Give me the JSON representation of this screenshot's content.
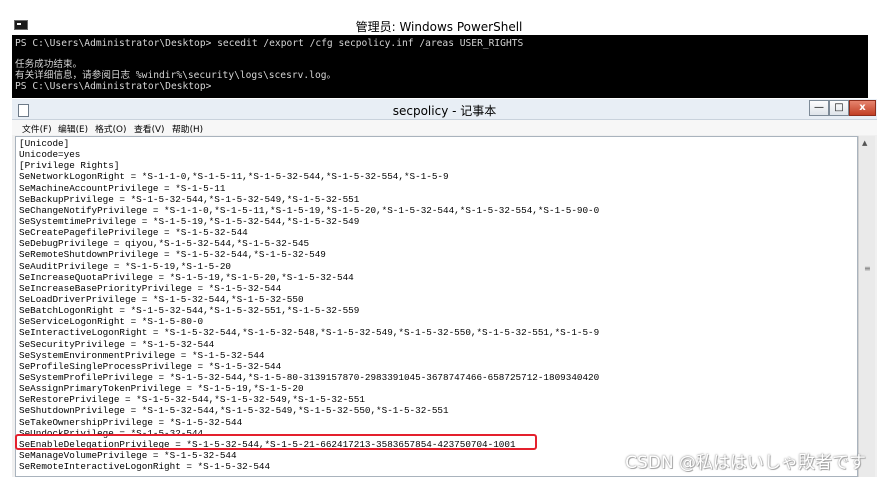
{
  "powershell": {
    "title": "管理员: Windows PowerShell",
    "lines": [
      "PS C:\\Users\\Administrator\\Desktop> secedit /export /cfg secpolicy.inf /areas USER_RIGHTS",
      "",
      "任务成功结束。",
      "有关详细信息，请参阅日志 %windir%\\security\\logs\\scesrv.log。",
      "PS C:\\Users\\Administrator\\Desktop>"
    ]
  },
  "notepad": {
    "title": "secpolicy - 记事本",
    "controls": {
      "minimize": "—",
      "maximize": "□",
      "close": "x"
    },
    "menu": [
      "文件(F)",
      "编辑(E)",
      "格式(O)",
      "查看(V)",
      "帮助(H)"
    ],
    "lines": [
      "[Unicode]",
      "Unicode=yes",
      "[Privilege Rights]",
      "SeNetworkLogonRight = *S-1-1-0,*S-1-5-11,*S-1-5-32-544,*S-1-5-32-554,*S-1-5-9",
      "SeMachineAccountPrivilege = *S-1-5-11",
      "SeBackupPrivilege = *S-1-5-32-544,*S-1-5-32-549,*S-1-5-32-551",
      "SeChangeNotifyPrivilege = *S-1-1-0,*S-1-5-11,*S-1-5-19,*S-1-5-20,*S-1-5-32-544,*S-1-5-32-554,*S-1-5-90-0",
      "SeSystemtimePrivilege = *S-1-5-19,*S-1-5-32-544,*S-1-5-32-549",
      "SeCreatePagefilePrivilege = *S-1-5-32-544",
      "SeDebugPrivilege = qiyou,*S-1-5-32-544,*S-1-5-32-545",
      "SeRemoteShutdownPrivilege = *S-1-5-32-544,*S-1-5-32-549",
      "SeAuditPrivilege = *S-1-5-19,*S-1-5-20",
      "SeIncreaseQuotaPrivilege = *S-1-5-19,*S-1-5-20,*S-1-5-32-544",
      "SeIncreaseBasePriorityPrivilege = *S-1-5-32-544",
      "SeLoadDriverPrivilege = *S-1-5-32-544,*S-1-5-32-550",
      "SeBatchLogonRight = *S-1-5-32-544,*S-1-5-32-551,*S-1-5-32-559",
      "SeServiceLogonRight = *S-1-5-80-0",
      "SeInteractiveLogonRight = *S-1-5-32-544,*S-1-5-32-548,*S-1-5-32-549,*S-1-5-32-550,*S-1-5-32-551,*S-1-5-9",
      "SeSecurityPrivilege = *S-1-5-32-544",
      "SeSystemEnvironmentPrivilege = *S-1-5-32-544",
      "SeProfileSingleProcessPrivilege = *S-1-5-32-544",
      "SeSystemProfilePrivilege = *S-1-5-32-544,*S-1-5-80-3139157870-2983391045-3678747466-658725712-1809340420",
      "SeAssignPrimaryTokenPrivilege = *S-1-5-19,*S-1-5-20",
      "SeRestorePrivilege = *S-1-5-32-544,*S-1-5-32-549,*S-1-5-32-551",
      "SeShutdownPrivilege = *S-1-5-32-544,*S-1-5-32-549,*S-1-5-32-550,*S-1-5-32-551",
      "SeTakeOwnershipPrivilege = *S-1-5-32-544",
      "SeUndockPrivilege = *S-1-5-32-544",
      "SeEnableDelegationPrivilege = *S-1-5-32-544,*S-1-5-21-662417213-3583657854-423750704-1001",
      "SeManageVolumePrivilege = *S-1-5-32-544",
      "SeRemoteInteractiveLogonRight = *S-1-5-32-544"
    ]
  },
  "watermark": "CSDN @私ははいしゃ敗者です",
  "colors": {
    "highlight": "#e4202d",
    "console_bg": "#000000"
  }
}
